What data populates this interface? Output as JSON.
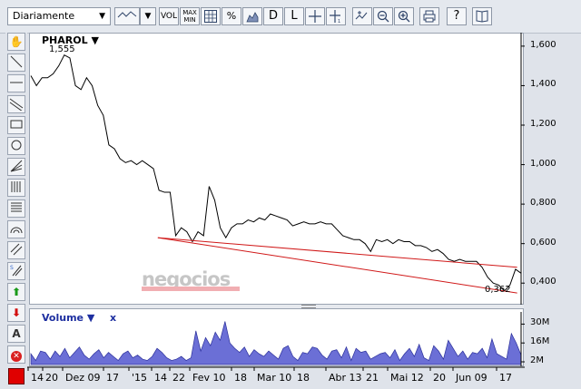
{
  "toolbar": {
    "period": "Diariamente",
    "vol": "VOL",
    "max": "MAX",
    "min": "MIN",
    "pct": "%",
    "d": "D",
    "l": "L",
    "help": "?"
  },
  "legend": {
    "symbol": "PHAROL ▼",
    "volume": "Volume ▼",
    "volume_close": "x"
  },
  "watermark": "negocios",
  "chart_data": {
    "type": "line",
    "title": "PHAROL",
    "ylim": [
      0.3,
      1.65
    ],
    "y_ticks": [
      "1,600",
      "1,400",
      "1,200",
      "1,000",
      "0,800",
      "0,600",
      "0,400"
    ],
    "y_tick_values": [
      1.6,
      1.4,
      1.2,
      1.0,
      0.8,
      0.6,
      0.4
    ],
    "x_labels": [
      "14",
      "20",
      "Dez 09",
      "17",
      "'15",
      "14",
      "22",
      "Fev 10",
      "18",
      "Mar 10",
      "18",
      "Abr 13",
      "21",
      "Mai 12",
      "20",
      "Jun 09",
      "17"
    ],
    "annotations": {
      "max": "1,555",
      "min": "0,362"
    },
    "max_value": 1.555,
    "min_value": 0.362,
    "price": [
      1.45,
      1.4,
      1.44,
      1.44,
      1.46,
      1.5,
      1.555,
      1.54,
      1.4,
      1.38,
      1.44,
      1.4,
      1.3,
      1.25,
      1.1,
      1.08,
      1.03,
      1.01,
      1.02,
      1.0,
      1.02,
      1.0,
      0.98,
      0.87,
      0.86,
      0.86,
      0.64,
      0.68,
      0.66,
      0.61,
      0.66,
      0.64,
      0.89,
      0.82,
      0.68,
      0.63,
      0.68,
      0.7,
      0.7,
      0.72,
      0.71,
      0.73,
      0.72,
      0.75,
      0.74,
      0.73,
      0.72,
      0.69,
      0.7,
      0.71,
      0.7,
      0.7,
      0.71,
      0.7,
      0.7,
      0.67,
      0.64,
      0.63,
      0.62,
      0.62,
      0.6,
      0.56,
      0.62,
      0.61,
      0.62,
      0.6,
      0.62,
      0.61,
      0.61,
      0.59,
      0.59,
      0.58,
      0.56,
      0.57,
      0.55,
      0.52,
      0.51,
      0.52,
      0.51,
      0.51,
      0.51,
      0.48,
      0.43,
      0.4,
      0.39,
      0.36,
      0.39,
      0.47,
      0.45
    ],
    "trendlines": [
      {
        "from": [
          0.259,
          0.63
        ],
        "to": [
          0.992,
          0.48
        ]
      },
      {
        "from": [
          0.259,
          0.63
        ],
        "to": [
          0.992,
          0.35
        ]
      }
    ],
    "volume": {
      "ylim": [
        0,
        35
      ],
      "y_ticks": [
        "30M",
        "16M",
        "2M"
      ],
      "y_tick_values": [
        30,
        16,
        2
      ],
      "values": [
        8,
        3,
        10,
        9,
        4,
        10,
        6,
        12,
        5,
        9,
        13,
        7,
        4,
        8,
        11,
        5,
        9,
        6,
        3,
        8,
        10,
        5,
        7,
        4,
        3,
        6,
        12,
        9,
        5,
        3,
        4,
        6,
        3,
        5,
        25,
        10,
        20,
        14,
        24,
        18,
        32,
        16,
        12,
        9,
        13,
        6,
        11,
        8,
        6,
        10,
        7,
        4,
        12,
        14,
        6,
        3,
        9,
        8,
        13,
        12,
        7,
        4,
        10,
        11,
        5,
        13,
        3,
        12,
        9,
        10,
        4,
        6,
        8,
        9,
        5,
        11,
        3,
        8,
        12,
        6,
        15,
        5,
        3,
        14,
        10,
        4,
        18,
        12,
        6,
        10,
        4,
        9,
        8,
        12,
        5,
        19,
        8,
        6,
        4,
        23,
        16,
        7
      ]
    }
  }
}
